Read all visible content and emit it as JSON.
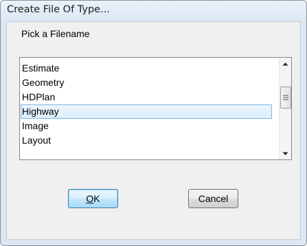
{
  "window": {
    "title": "Create File Of Type..."
  },
  "dialog": {
    "prompt": "Pick a Filename",
    "list": {
      "items": [
        "Estimate",
        "Geometry",
        "HDPlan",
        "Highway",
        "Image",
        "Layout"
      ],
      "selected_index": 3,
      "scroll_position": 0.3
    },
    "buttons": {
      "ok_mnemonic": "O",
      "ok_rest": "K",
      "cancel_label": "Cancel"
    }
  },
  "icons": {
    "scroll_up": "scroll-up-arrow-icon",
    "scroll_down": "scroll-down-arrow-icon",
    "thumb_grip": "scroll-grip-icon"
  },
  "colors": {
    "selection_border": "#7fb4e0",
    "default_button_border": "#3c7fb1",
    "titlebar": "#dce7f3"
  }
}
